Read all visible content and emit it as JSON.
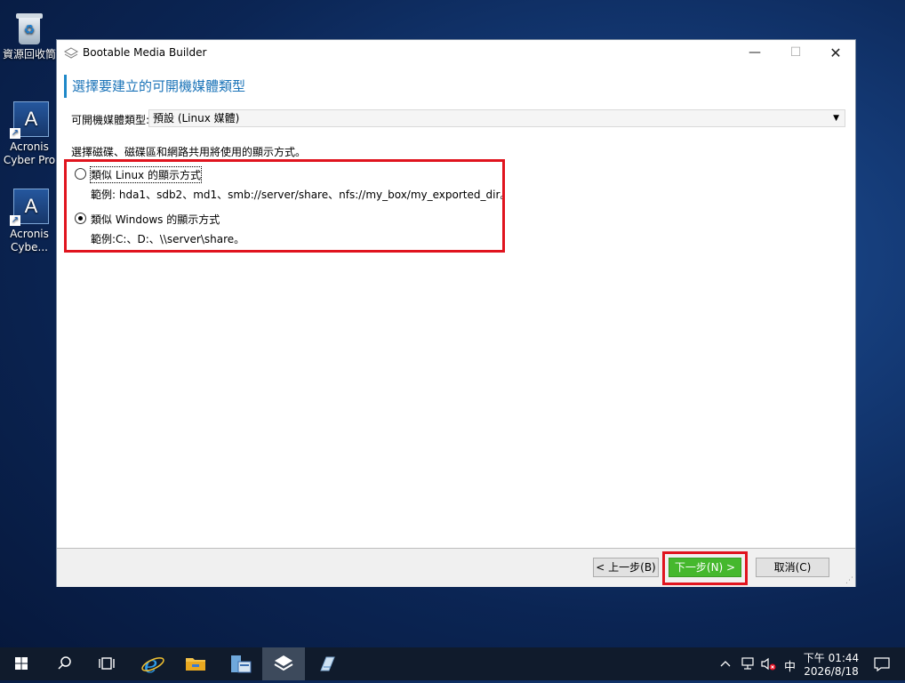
{
  "desktop": {
    "icons": [
      {
        "label": "資源回收筒"
      },
      {
        "label": "Acronis Cyber Pro"
      },
      {
        "label": "Acronis Cybe..."
      }
    ]
  },
  "window": {
    "title": "Bootable Media Builder",
    "controls": {
      "minimize": "—",
      "maximize": "☐",
      "close": "✕"
    },
    "header": "選擇要建立的可開機媒體類型",
    "media_type": {
      "label": "可開機媒體類型:",
      "value": "預設 (Linux 媒體)"
    },
    "instruction": "選擇磁碟、磁碟區和網路共用將使用的顯示方式。",
    "options": [
      {
        "label": "類似 Linux 的顯示方式",
        "example": "範例: hda1、sdb2、md1、smb://server/share、nfs://my_box/my_exported_dir。",
        "selected": false
      },
      {
        "label": "類似 Windows 的顯示方式",
        "example": "範例:C:、D:、\\\\server\\share。",
        "selected": true
      }
    ],
    "buttons": {
      "back": "< 上一步(B)",
      "next": "下一步(N) >",
      "cancel": "取消(C)"
    }
  },
  "taskbar": {
    "tray": {
      "ime": "中",
      "time": "下午 01:44",
      "date": "2026/8/18"
    }
  },
  "colors": {
    "accent": "#1a73b8",
    "highlight": "#e0141e",
    "next_button": "#45b82d"
  }
}
